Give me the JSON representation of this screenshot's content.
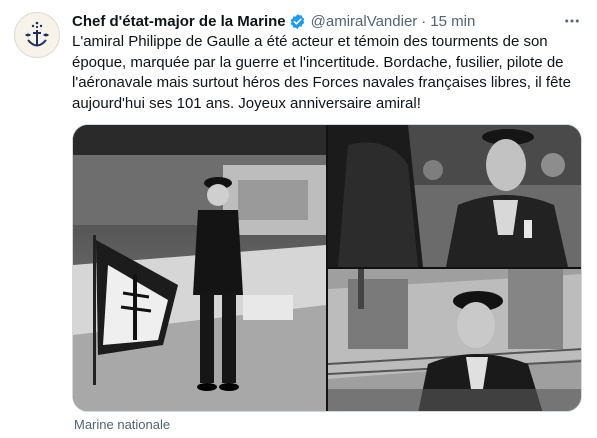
{
  "account": {
    "display_name": "Chef d'état-major de la Marine",
    "handle": "@amiralVandier",
    "separator": "·",
    "time": "15 min",
    "verified_color": "#1d9bf0"
  },
  "tweet": {
    "text": "L'amiral Philippe de Gaulle a été acteur et témoin des tourments de son\népoque, marquée par la guerre et l'incertitude. Bordache, fusilier, pilote de\nl'aéronavale mais surtout héros des Forces navales françaises libres, il fête\naujourd'hui ses 101 ans. Joyeux anniversaire amiral!"
  },
  "media": {
    "images": [
      {
        "name": "officer-on-boat-photo"
      },
      {
        "name": "young-officer-portrait-photo"
      },
      {
        "name": "officer-aboard-ship-photo"
      }
    ]
  },
  "footer": {
    "source": "Marine nationale"
  },
  "icons": {
    "avatar": "navy-anchor-logo-icon",
    "verified": "verified-badge-icon",
    "more": "more-options-icon"
  }
}
